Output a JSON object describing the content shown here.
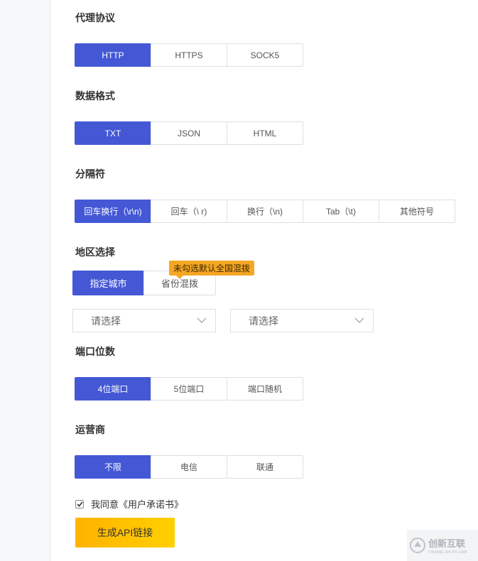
{
  "proxy_protocol": {
    "title": "代理协议",
    "options": [
      "HTTP",
      "HTTPS",
      "SOCK5"
    ],
    "selected": "HTTP"
  },
  "data_format": {
    "title": "数据格式",
    "options": [
      "TXT",
      "JSON",
      "HTML"
    ],
    "selected": "TXT"
  },
  "separator": {
    "title": "分隔符",
    "options": [
      "回车换行（\\r\\n)",
      "回车（\\ r)",
      "换行（\\n)",
      "Tab（\\t)",
      "其他符号"
    ],
    "selected": "回车换行（\\r\\n)"
  },
  "region": {
    "title": "地区选择",
    "options": [
      "指定城市",
      "省份混拨"
    ],
    "selected": "指定城市",
    "tooltip": "未勾选默认全国混拨",
    "province_select": {
      "placeholder": "请选择"
    },
    "city_select": {
      "placeholder": "请选择"
    }
  },
  "port_count": {
    "title": "端口位数",
    "options": [
      "4位端口",
      "5位端口",
      "端口随机"
    ],
    "selected": "4位端口"
  },
  "carrier": {
    "title": "运营商",
    "options": [
      "不限",
      "电信",
      "联通"
    ],
    "selected": "不限"
  },
  "agreement": {
    "checked": true,
    "prefix": "我同意",
    "link": "《用户承诺书》"
  },
  "generate_button": "生成API链接",
  "watermark": {
    "brand": "创新互联",
    "sub": "CHUANG XIN HU LIAN"
  },
  "colors": {
    "accent": "#4458d6",
    "button_yellow": "#ffc400",
    "tooltip": "#f5a623"
  }
}
